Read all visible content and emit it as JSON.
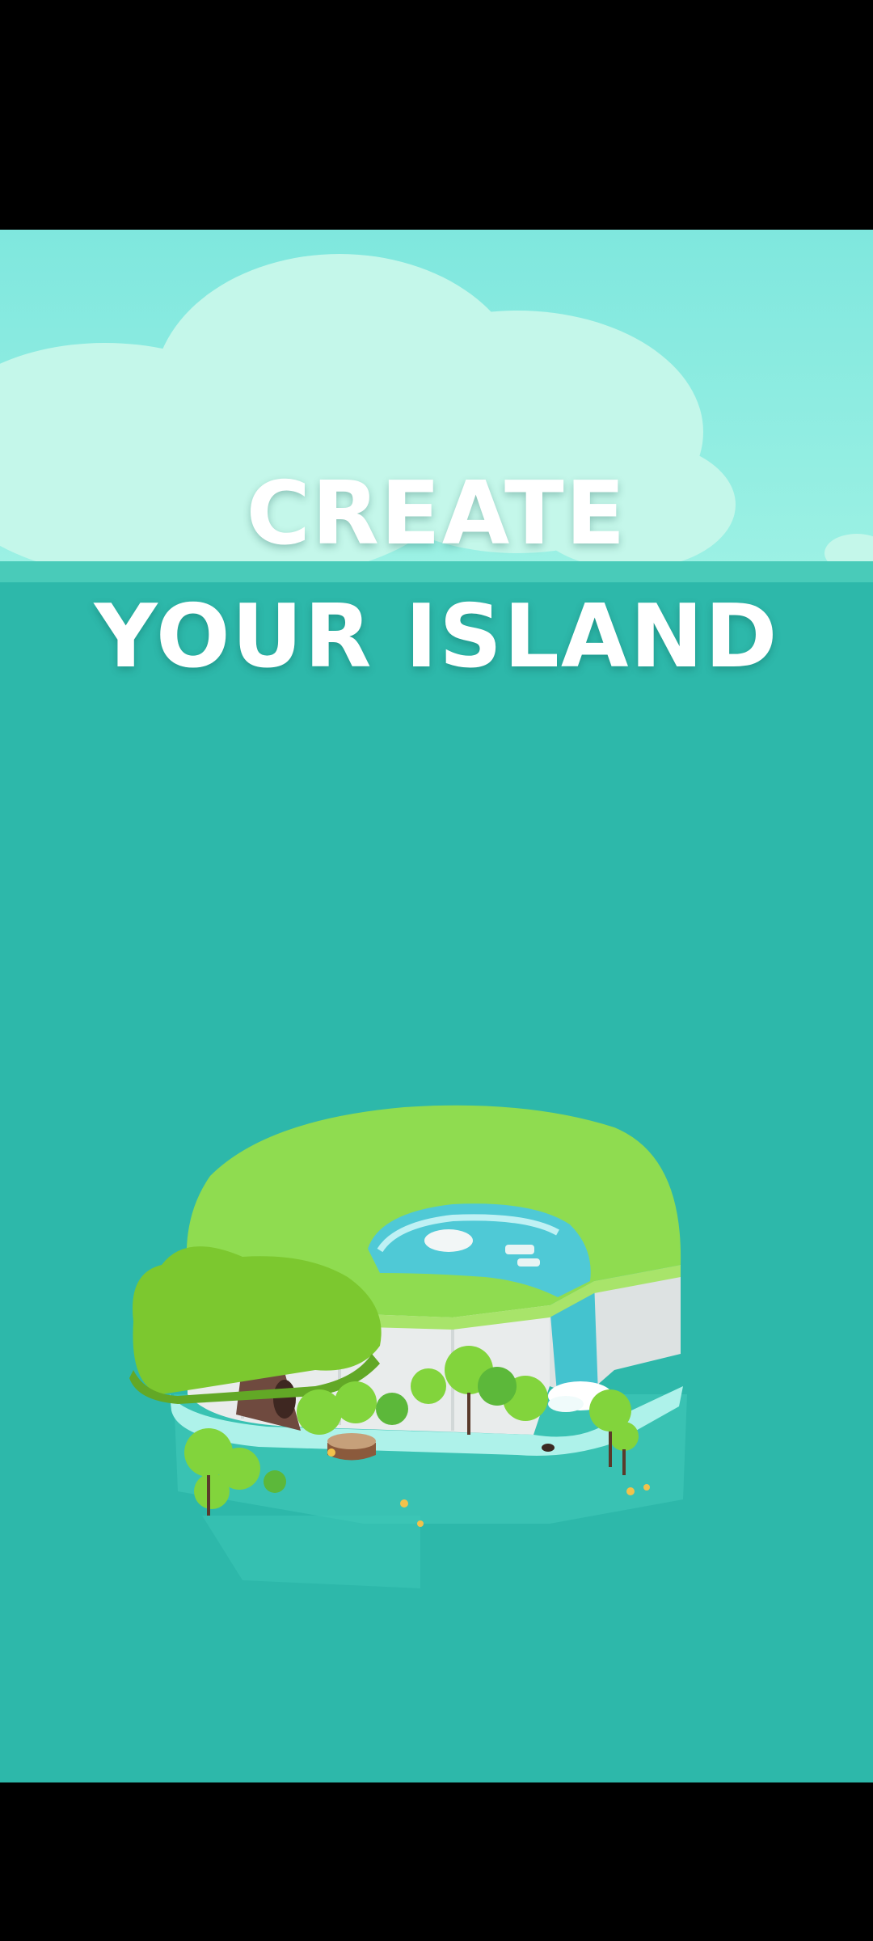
{
  "title": {
    "line1": "CREATE",
    "line2": "YOUR ISLAND"
  },
  "colors": {
    "letterbox": "#000000",
    "sky_top": "#7fe7de",
    "sky_bottom": "#9af0e3",
    "cloud": "#c2f6ea",
    "sea": "#2db8aa",
    "horizon": "#39c1b0",
    "grass": "#8fdc50",
    "tree_canopy": "#7cc82f",
    "cliff": "#e9ecec",
    "pond": "#4fc9d6",
    "title_text": "#ffffff"
  },
  "icons": {
    "island": "island-illustration",
    "big_tree": "tree-icon",
    "stump": "stump-icon",
    "waterfall": "waterfall-icon"
  }
}
